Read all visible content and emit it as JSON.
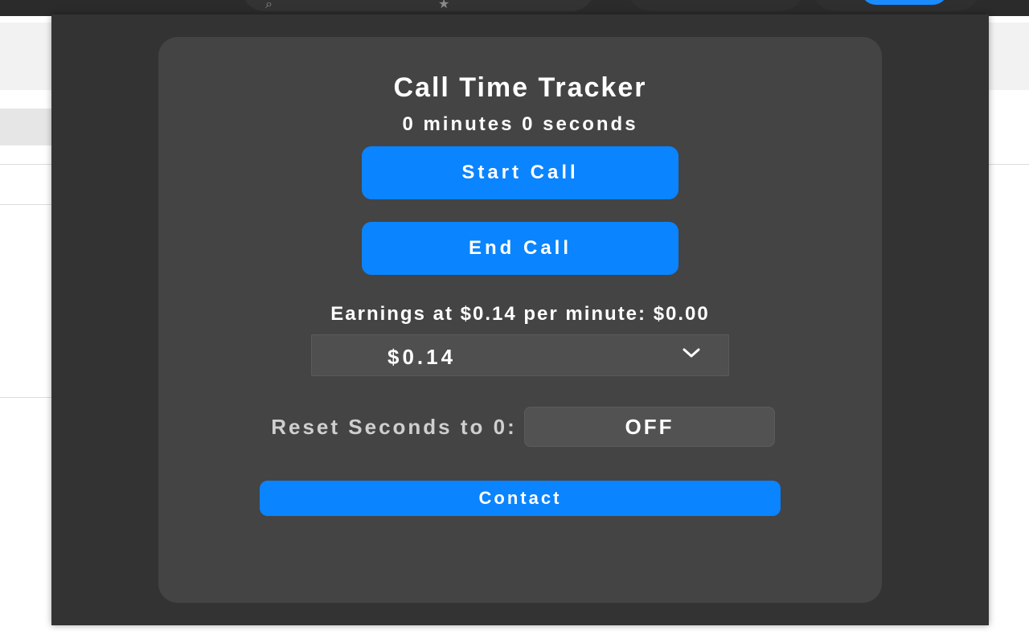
{
  "popup": {
    "title": "Call Time Tracker",
    "timer_text": "0 minutes 0 seconds",
    "start_button_label": "Start Call",
    "end_button_label": "End Call",
    "earnings_text": "Earnings at $0.14 per minute: $0.00",
    "rate_select_value": "$0.14",
    "reset_label": "Reset Seconds to 0:",
    "reset_toggle_value": "OFF",
    "contact_button_label": "Contact"
  },
  "colors": {
    "accent": "#0a84ff",
    "popup_background": "#333333",
    "card_background": "#444444"
  },
  "icons": [
    "search-icon",
    "star-icon",
    "chevron-down-icon"
  ]
}
